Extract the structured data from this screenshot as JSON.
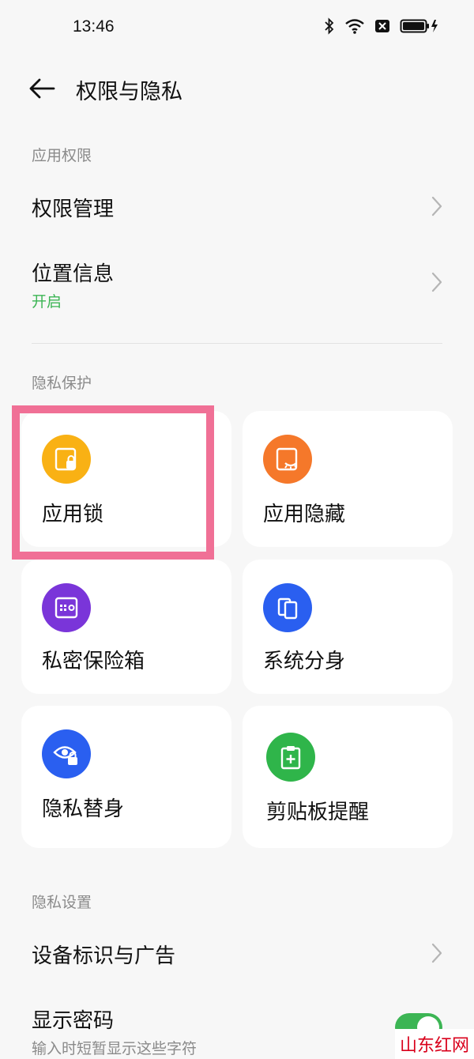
{
  "status_bar": {
    "time": "13:46"
  },
  "header": {
    "title": "权限与隐私"
  },
  "sections": {
    "app_permissions": "应用权限",
    "privacy_protection": "隐私保护",
    "privacy_settings": "隐私设置"
  },
  "rows": {
    "permission_management": {
      "title": "权限管理"
    },
    "location": {
      "title": "位置信息",
      "status": "开启"
    },
    "device_id_ads": {
      "title": "设备标识与广告"
    },
    "show_password": {
      "title": "显示密码",
      "subtitle": "输入时短暂显示这些字符"
    }
  },
  "cards": {
    "app_lock": {
      "label": "应用锁",
      "icon": "app-lock-icon",
      "color": "#f9b114"
    },
    "app_hide": {
      "label": "应用隐藏",
      "icon": "app-hide-icon",
      "color": "#f5782a"
    },
    "private_safe": {
      "label": "私密保险箱",
      "icon": "safe-icon",
      "color": "#7a35d9"
    },
    "app_clone": {
      "label": "系统分身",
      "icon": "clone-icon",
      "color": "#2a5ff0"
    },
    "privacy_standin": {
      "label": "隐私替身",
      "icon": "eye-lock-icon",
      "color": "#2a5ff0"
    },
    "clipboard_alert": {
      "label": "剪贴板提醒",
      "icon": "clipboard-icon",
      "color": "#2fb54a"
    }
  },
  "colors": {
    "accent_green": "#3cb554",
    "highlight": "#f07096"
  },
  "toggle_show_password": "on",
  "watermark": "山东红网"
}
